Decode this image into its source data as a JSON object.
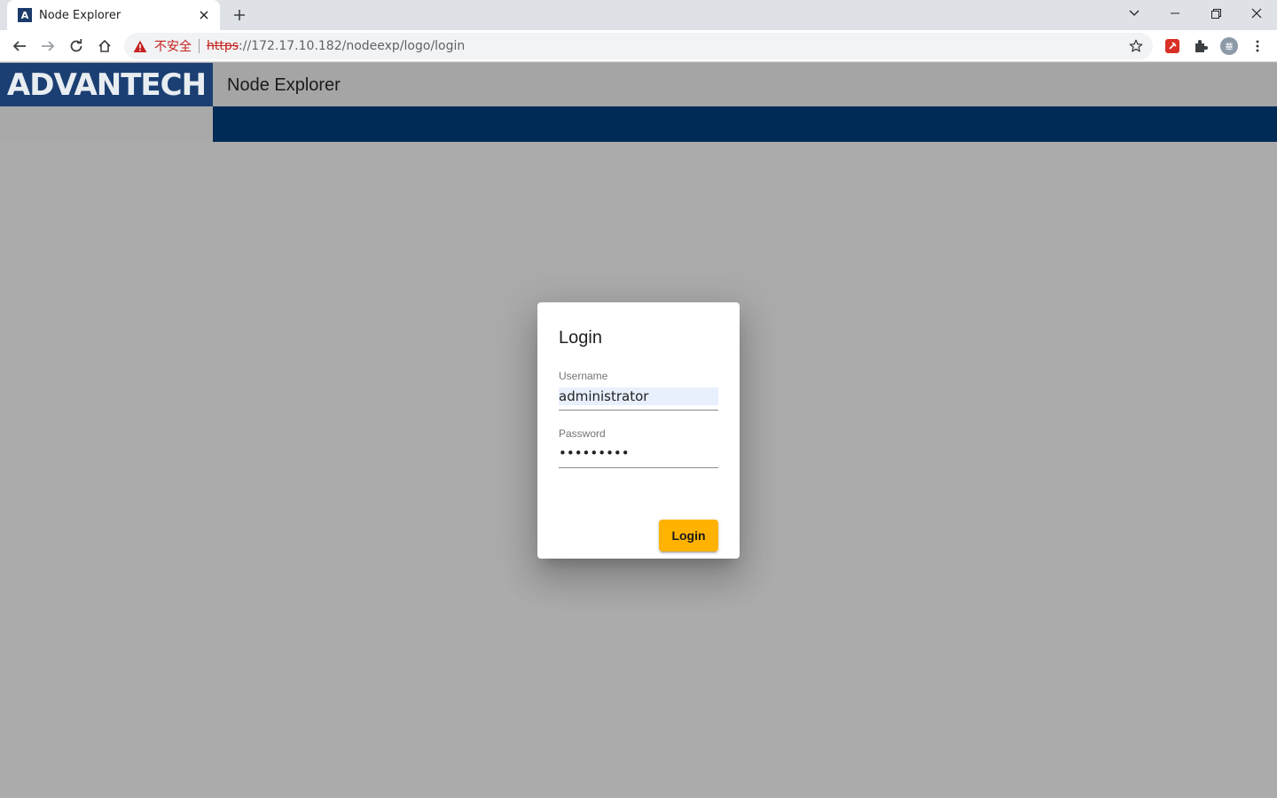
{
  "browser": {
    "tab": {
      "title": "Node Explorer",
      "favicon": "advantech-a-icon"
    },
    "address": {
      "security_label": "不安全",
      "url_scheme": "https",
      "url_rest": "://172.17.10.182/nodeexp/logo/login"
    },
    "profile_initial": "華"
  },
  "app": {
    "logo_text": "ADVANTECH",
    "title": "Node Explorer",
    "colors": {
      "nav_bar": "#002b56",
      "logo_bg": "#1b3f72",
      "accent": "#ffb300"
    }
  },
  "login_dialog": {
    "title": "Login",
    "username": {
      "label": "Username",
      "value": "administrator"
    },
    "password": {
      "label": "Password",
      "value": "•••••••••"
    },
    "submit_label": "Login"
  }
}
